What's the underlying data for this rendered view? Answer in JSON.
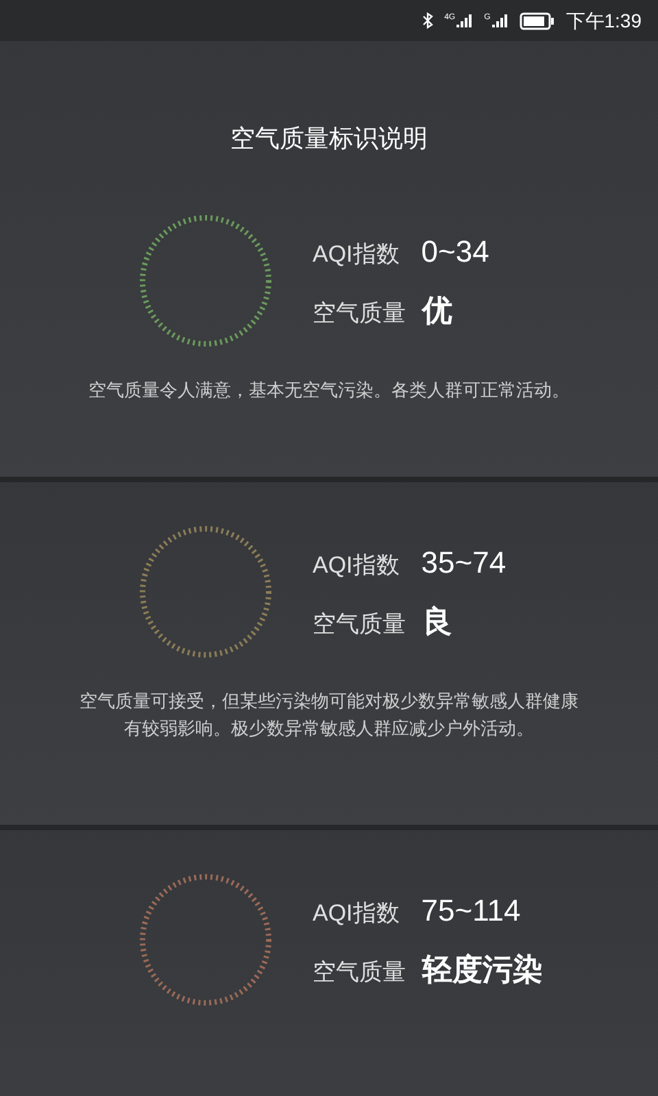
{
  "status_bar": {
    "network_1": "4G",
    "network_2": "G",
    "time": "下午1:39"
  },
  "title": "空气质量标识说明",
  "levels": [
    {
      "aqi_label": "AQI指数",
      "aqi_range": "0~34",
      "quality_label": "空气质量",
      "quality": "优",
      "color": "#6b9a5c",
      "description": "空气质量令人满意，基本无空气污染。各类人群可正常活动。"
    },
    {
      "aqi_label": "AQI指数",
      "aqi_range": "35~74",
      "quality_label": "空气质量",
      "quality": "良",
      "color": "#8c7d58",
      "description": "空气质量可接受，但某些污染物可能对极少数异常敏感人群健康有较弱影响。极少数异常敏感人群应减少户外活动。"
    },
    {
      "aqi_label": "AQI指数",
      "aqi_range": "75~114",
      "quality_label": "空气质量",
      "quality": "轻度污染",
      "color": "#9a6a58"
    }
  ]
}
